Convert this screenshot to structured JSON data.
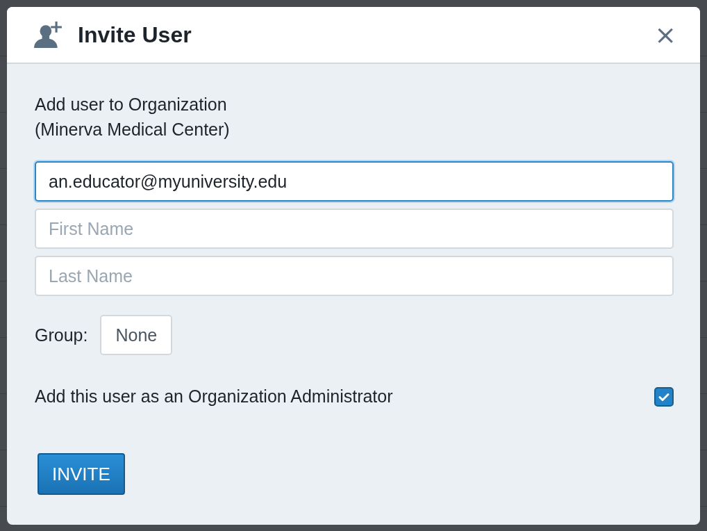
{
  "dialog": {
    "title": "Invite User",
    "close": "×"
  },
  "intro": [
    "Add user to Organization",
    "(Minerva Medical Center)"
  ],
  "fields": [
    {
      "kind": "value",
      "value": "an.educator@myuniversity.edu",
      "focused": true
    },
    {
      "kind": "placeholder",
      "placeholder": "First Name",
      "focused": false
    },
    {
      "kind": "placeholder",
      "placeholder": "Last Name",
      "focused": false
    }
  ],
  "group": {
    "label": "Group:",
    "value": "None"
  },
  "admin": {
    "label": "Add this user as an Organization Administrator",
    "checked": true
  },
  "submit": "INVITE"
}
